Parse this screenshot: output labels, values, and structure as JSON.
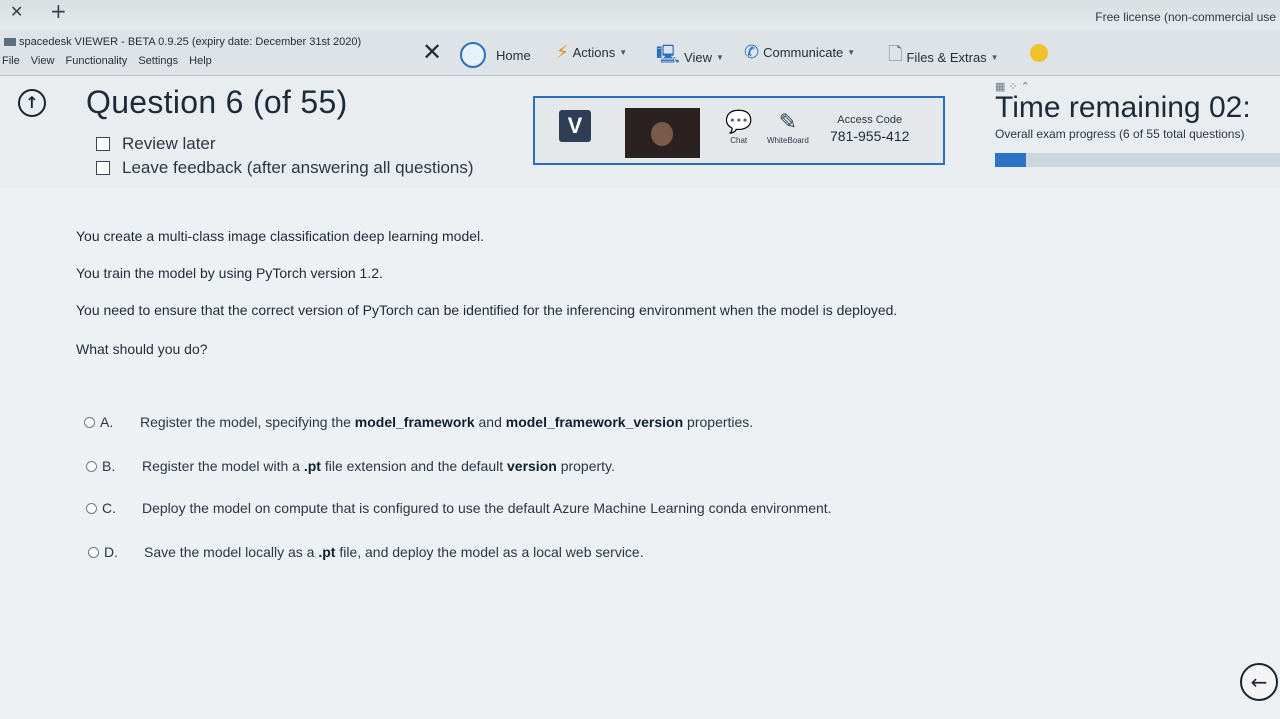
{
  "browser": {
    "close_glyph": "✕",
    "plus_glyph": "+",
    "license": "Free license (non-commercial use"
  },
  "viewer": {
    "title": "spacedesk VIEWER - BETA 0.9.25 (expiry date: December 31st 2020)",
    "menu": [
      "File",
      "View",
      "Functionality",
      "Settings",
      "Help"
    ],
    "toolbar": {
      "close": "✕",
      "home": "Home",
      "actions": "Actions",
      "view": "View",
      "communicate": "Communicate",
      "files": "Files & Extras"
    }
  },
  "question": {
    "title": "Question 6 (of 55)",
    "review_later": "Review later",
    "leave_feedback": "Leave feedback (after answering all questions)"
  },
  "remote": {
    "v_label": "V",
    "chat": "Chat",
    "whiteboard": "WhiteBoard",
    "access_label": "Access Code",
    "access_code": "781-955-412"
  },
  "timer": {
    "remaining": "Time remaining 02:",
    "progress_text": "Overall exam progress (6 of 55 total questions)",
    "progress_fraction": 0.109
  },
  "stem": [
    "You create a multi-class image classification deep learning model.",
    "You train the model by using PyTorch version 1.2.",
    "You need to ensure that the correct version of PyTorch can be identified for the inferencing environment when the model is deployed.",
    "What should you do?"
  ],
  "options": [
    {
      "letter": "A.",
      "pre": "Register the model, specifying the ",
      "b1": "model_framework",
      "mid": " and ",
      "b2": "model_framework_version",
      "post": " properties."
    },
    {
      "letter": "B.",
      "pre": "Register the model with a ",
      "b1": ".pt",
      "mid": " file extension and the default ",
      "b2": "version",
      "post": " property."
    },
    {
      "letter": "C.",
      "pre": "Deploy the model on compute that is configured to use the default Azure Machine Learning conda environment.",
      "b1": "",
      "mid": "",
      "b2": "",
      "post": ""
    },
    {
      "letter": "D.",
      "pre": "Save the model locally as a ",
      "b1": ".pt",
      "mid": " file, and deploy the model as a local web service.",
      "b2": "",
      "post": ""
    }
  ],
  "colors": {
    "accent": "#2c74c4",
    "remote_border": "#2a6fbf"
  }
}
